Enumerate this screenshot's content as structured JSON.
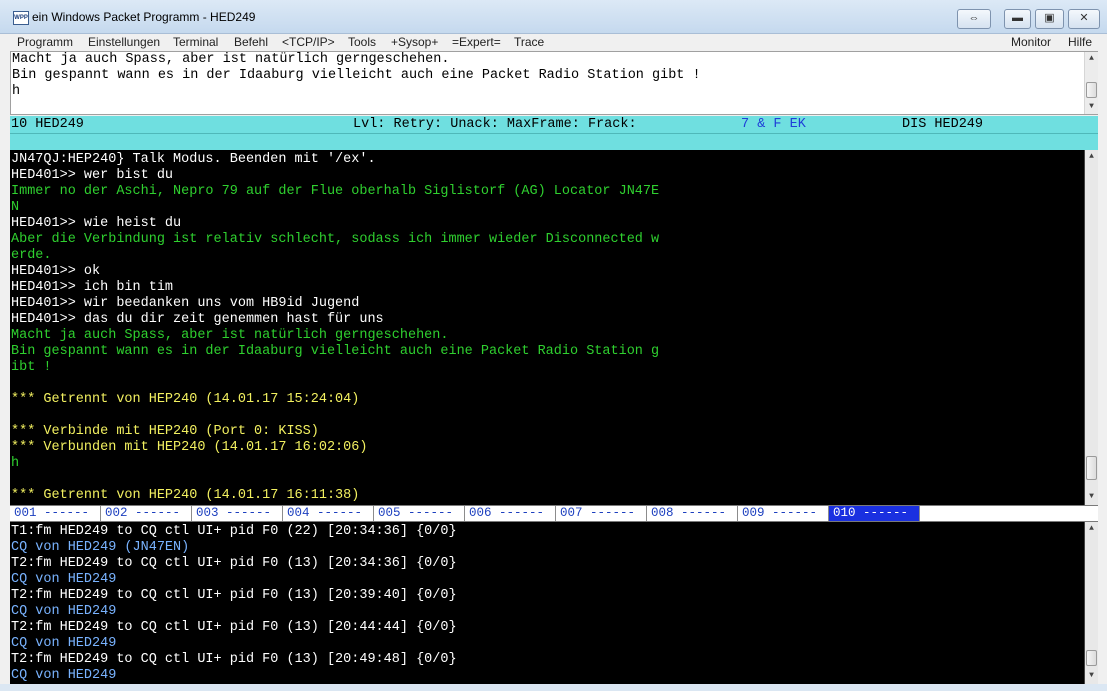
{
  "window": {
    "app_icon_label": "WPP",
    "title": "ein Windows Packet Programm - HED249"
  },
  "menu": {
    "left": [
      "Programm",
      "Einstellungen",
      "Terminal",
      "Befehl",
      "<TCP/IP>",
      "Tools",
      "+Sysop+",
      "=Expert=",
      "Trace"
    ],
    "right": [
      "Monitor",
      "Hilfe"
    ]
  },
  "input_panel": {
    "lines": [
      "Macht ja auch Spass, aber ist natürlich gerngeschehen.",
      "Bin gespannt wann es in der Idaaburg vielleicht auch eine Packet Radio Station gibt !",
      "h"
    ]
  },
  "status": {
    "channel": "10 HED249",
    "link_stats": "Lvl: Retry: Unack: MaxFrame: Frack:",
    "flags": "7 & F EK",
    "connection": "DIS HED249"
  },
  "terminal": {
    "lines": [
      {
        "t": "JN47QJ:HEP240} Talk Modus. Beenden mit '/ex'.",
        "c": "w"
      },
      {
        "t": "HED401>> wer bist du",
        "c": "w"
      },
      {
        "t": "Immer no der Aschi, Nepro 79 auf der Flue oberhalb Siglistorf (AG) Locator JN47E",
        "c": "g"
      },
      {
        "t": "N",
        "c": "g"
      },
      {
        "t": "HED401>> wie heist du",
        "c": "w"
      },
      {
        "t": "Aber die Verbindung ist relativ schlecht, sodass ich immer wieder Disconnected w",
        "c": "g"
      },
      {
        "t": "erde.",
        "c": "g"
      },
      {
        "t": "HED401>> ok",
        "c": "w"
      },
      {
        "t": "HED401>> ich bin tim",
        "c": "w"
      },
      {
        "t": "HED401>> wir beedanken uns vom HB9id Jugend",
        "c": "w"
      },
      {
        "t": "HED401>> das du dir zeit genemmen hast für uns",
        "c": "w"
      },
      {
        "t": "Macht ja auch Spass, aber ist natürlich gerngeschehen.",
        "c": "g"
      },
      {
        "t": "Bin gespannt wann es in der Idaaburg vielleicht auch eine Packet Radio Station g",
        "c": "g"
      },
      {
        "t": "ibt !",
        "c": "g"
      },
      {
        "t": "",
        "c": "w"
      },
      {
        "t": "*** Getrennt von HEP240 (14.01.17 15:24:04)",
        "c": "y"
      },
      {
        "t": "",
        "c": "w"
      },
      {
        "t": "*** Verbinde mit HEP240 (Port 0: KISS)",
        "c": "y"
      },
      {
        "t": "*** Verbunden mit HEP240 (14.01.17 16:02:06)",
        "c": "y"
      },
      {
        "t": "h",
        "c": "g"
      },
      {
        "t": "",
        "c": "w"
      },
      {
        "t": "*** Getrennt von HEP240 (14.01.17 16:11:38)",
        "c": "y"
      }
    ]
  },
  "channels": [
    "001 ------",
    "002 ------",
    "003 ------",
    "004 ------",
    "005 ------",
    "006 ------",
    "007 ------",
    "008 ------",
    "009 ------",
    "010 ------"
  ],
  "active_channel_index": 9,
  "monitor": {
    "lines": [
      {
        "t": "T1:fm HED249 to CQ ctl UI+ pid F0 (22) [20:34:36] {0/0}",
        "c": "w"
      },
      {
        "t": "CQ von HED249 (JN47EN)",
        "c": "c"
      },
      {
        "t": "T2:fm HED249 to CQ ctl UI+ pid F0 (13) [20:34:36] {0/0}",
        "c": "w"
      },
      {
        "t": "CQ von HED249",
        "c": "c"
      },
      {
        "t": "T2:fm HED249 to CQ ctl UI+ pid F0 (13) [20:39:40] {0/0}",
        "c": "w"
      },
      {
        "t": "CQ von HED249",
        "c": "c"
      },
      {
        "t": "T2:fm HED249 to CQ ctl UI+ pid F0 (13) [20:44:44] {0/0}",
        "c": "w"
      },
      {
        "t": "CQ von HED249",
        "c": "c"
      },
      {
        "t": "T2:fm HED249 to CQ ctl UI+ pid F0 (13) [20:49:48] {0/0}",
        "c": "w"
      },
      {
        "t": "CQ von HED249",
        "c": "c"
      }
    ]
  },
  "colors": {
    "status_bg": "#6fdfe0",
    "terminal_bg": "#000000",
    "text_white": "#ffffff",
    "text_green": "#2fd02f",
    "text_yellow": "#f2f060",
    "text_blue": "#79b3ff",
    "active_channel": "#1a30e0"
  }
}
